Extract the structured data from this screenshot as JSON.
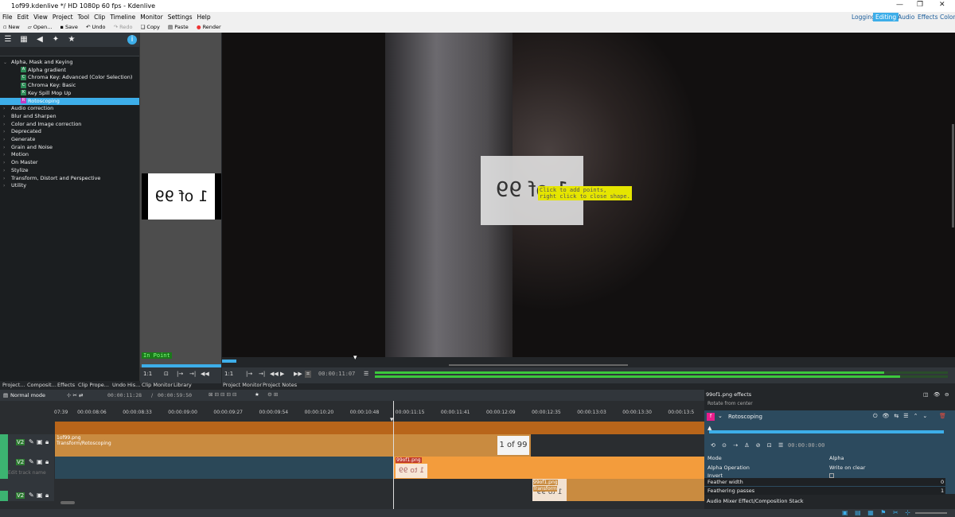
{
  "window": {
    "title": "1of99.kdenlive */ HD 1080p 60 fps - Kdenlive"
  },
  "menu": [
    "File",
    "Edit",
    "View",
    "Project",
    "Tool",
    "Clip",
    "Timeline",
    "Monitor",
    "Settings",
    "Help"
  ],
  "workspaces": [
    "Logging",
    "Editing",
    "Audio",
    "Effects",
    "Color"
  ],
  "toolbar": {
    "new": "New",
    "open": "Open...",
    "save": "Save",
    "undo": "Undo",
    "redo": "Redo",
    "copy": "Copy",
    "paste": "Paste",
    "render": "Render"
  },
  "effects_tree": {
    "category_open": "Alpha, Mask and Keying",
    "children": [
      {
        "badge": "A",
        "color": "#2e8b57",
        "label": "Alpha gradient"
      },
      {
        "badge": "C",
        "color": "#2e8b57",
        "label": "Chroma Key: Advanced (Color Selection)"
      },
      {
        "badge": "C",
        "color": "#2e8b57",
        "label": "Chroma Key: Basic"
      },
      {
        "badge": "K",
        "color": "#2e8b57",
        "label": "Key Spill Mop Up"
      },
      {
        "badge": "R",
        "color": "#c23cc2",
        "label": "Rotoscoping"
      }
    ],
    "categories": [
      "Audio correction",
      "Blur and Sharpen",
      "Color and Image correction",
      "Deprecated",
      "Generate",
      "Grain and Noise",
      "Motion",
      "On Master",
      "Stylize",
      "Transform, Distort and Perspective",
      "Utility"
    ]
  },
  "clip_monitor": {
    "image_text": "1 of 99",
    "in_point": "In Point",
    "zoom": "1:1"
  },
  "project_monitor": {
    "overlay_text": "1 of 99",
    "hint_line1": "Click to add points,",
    "hint_line2": "right click to close shape.",
    "zoom": "1:1",
    "timecode": "00:00:11:07"
  },
  "dock_tabs_left": [
    "Project...",
    "Composit...",
    "Effects",
    "Clip Prope...",
    "Undo His...",
    "Clip Monitor",
    "Library"
  ],
  "dock_tabs_mid": [
    "Project Monitor",
    "Project Notes"
  ],
  "timeline": {
    "mode": "Normal mode",
    "position": "00:00:11:28",
    "duration": "00:00:59:50",
    "ruler": [
      "07:39",
      "00:00:08:06",
      "00:00:08:33",
      "00:00:09:00",
      "00:00:09:27",
      "00:00:09:54",
      "00:00:10:20",
      "00:00:10:48",
      "00:00:11:15",
      "00:00:11:41",
      "00:00:12:09",
      "00:00:12:35",
      "00:00:13:03",
      "00:00:13:30",
      "00:00:13:5"
    ],
    "track_label": "V2",
    "edit_track_name": "Edit track name",
    "clips": [
      {
        "name": "1of99.png",
        "effect": "Transform/Rotoscoping",
        "thumb": "1 of 99"
      },
      {
        "name": "99of1.png",
        "thumb": "1 to 99"
      },
      {
        "name": "99of1.png",
        "effect": "Transform",
        "thumb": "1 to 99"
      }
    ]
  },
  "effect_stack": {
    "title": "99of1.png effects",
    "cut_text": "Rotate from center",
    "effect_name": "Rotoscoping",
    "timecode": "00:00:00:00",
    "params": [
      {
        "label": "Mode",
        "value": "Alpha"
      },
      {
        "label": "Alpha Operation",
        "value": "Write on clear"
      },
      {
        "label": "Invert",
        "value": ""
      },
      {
        "label": "Feather width",
        "value": "0"
      },
      {
        "label": "Feathering passes",
        "value": "1"
      }
    ],
    "tabs": [
      "Audio Mixer",
      "Effect/Composition Stack"
    ]
  }
}
